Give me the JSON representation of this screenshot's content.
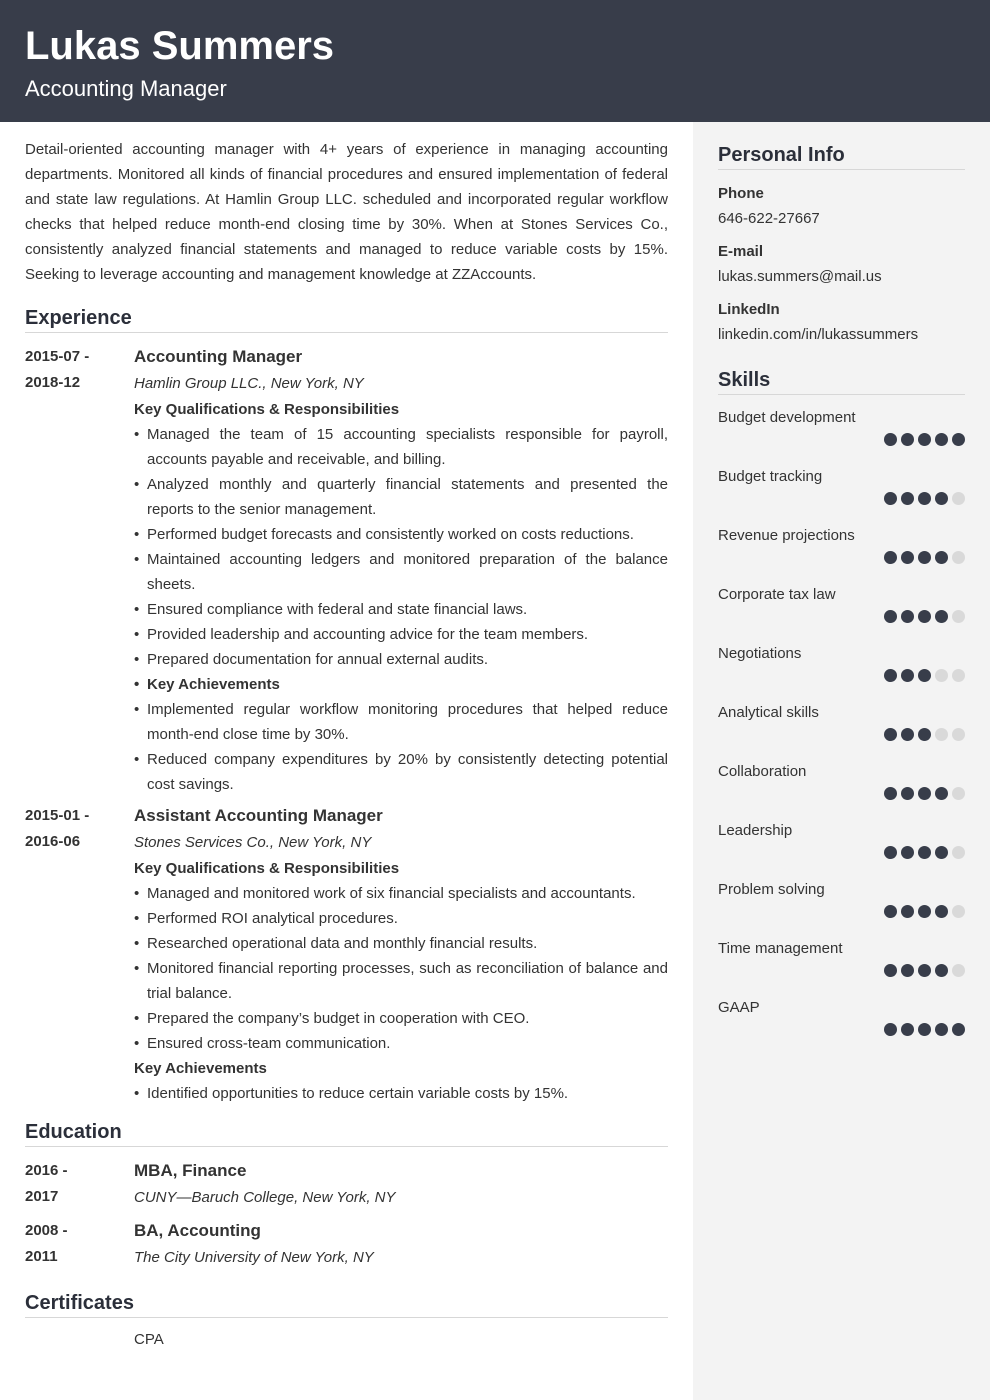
{
  "header": {
    "name": "Lukas Summers",
    "title": "Accounting Manager"
  },
  "summary": "Detail-oriented accounting manager with 4+ years of experience in managing accounting departments. Monitored all kinds of financial procedures and ensured implementation of federal and state law regulations. At Hamlin Group LLC. scheduled and incorporated regular workflow checks that helped reduce month-end closing time by 30%. When at Stones Services Co., consistently analyzed financial statements and managed to reduce variable costs by 15%. Seeking to leverage accounting and management knowledge at ZZAccounts.",
  "experience": {
    "heading": "Experience",
    "jobs": [
      {
        "date_start": "2015-07 -",
        "date_end": "2018-12",
        "title": "Accounting Manager",
        "company": "Hamlin Group LLC., New York, NY",
        "qual_heading": "Key Qualifications & Responsibilities",
        "bullets": [
          "Managed the team of 15 accounting specialists responsible for payroll, accounts payable and receivable, and billing.",
          "Analyzed monthly and quarterly financial statements and presented the reports to the senior management.",
          "Performed budget forecasts and consistently worked on costs reductions.",
          "Maintained accounting ledgers and monitored preparation of the balance sheets.",
          "Ensured compliance with federal and state financial laws.",
          "Provided leadership and accounting advice for the team members.",
          "Prepared documentation for annual external audits."
        ],
        "achievements_heading": "Key Achievements",
        "achievements": [
          "Implemented regular workflow monitoring procedures that helped reduce month-end close time by 30%.",
          "Reduced company expenditures by 20% by consistently detecting potential cost savings."
        ]
      },
      {
        "date_start": "2015-01 -",
        "date_end": "2016-06",
        "title": "Assistant Accounting Manager",
        "company": "Stones Services Co., New York, NY",
        "qual_heading": "Key Qualifications & Responsibilities",
        "bullets": [
          "Managed and monitored work of six financial specialists and accountants.",
          "Performed ROI analytical procedures.",
          "Researched operational data and monthly financial results.",
          "Monitored financial reporting processes, such as reconciliation of balance and trial balance.",
          "Prepared the company’s budget in cooperation with CEO.",
          "Ensured cross-team communication."
        ],
        "achievements_heading": "Key Achievements",
        "achievements": [
          "Identified opportunities to reduce certain variable costs by 15%."
        ]
      }
    ]
  },
  "education": {
    "heading": "Education",
    "items": [
      {
        "date_start": "2016 -",
        "date_end": "2017",
        "degree": "MBA, Finance",
        "school": "CUNY—Baruch College, New York, NY"
      },
      {
        "date_start": "2008 -",
        "date_end": "2011",
        "degree": "BA, Accounting",
        "school": "The City University of New York, NY"
      }
    ]
  },
  "certificates": {
    "heading": "Certificates",
    "items": [
      "CPA"
    ]
  },
  "personal_info": {
    "heading": "Personal Info",
    "phone_label": "Phone",
    "phone": "646-622-27667",
    "email_label": "E-mail",
    "email": "lukas.summers@mail.us",
    "linkedin_label": "LinkedIn",
    "linkedin": "linkedin.com/in/lukassummers"
  },
  "skills": {
    "heading": "Skills",
    "max_level": 5,
    "items": [
      {
        "name": "Budget development",
        "level": 5
      },
      {
        "name": "Budget tracking",
        "level": 4
      },
      {
        "name": "Revenue projections",
        "level": 4
      },
      {
        "name": "Corporate tax law",
        "level": 4
      },
      {
        "name": "Negotiations",
        "level": 3
      },
      {
        "name": "Analytical skills",
        "level": 3
      },
      {
        "name": "Collaboration",
        "level": 4
      },
      {
        "name": "Leadership",
        "level": 4
      },
      {
        "name": "Problem solving",
        "level": 4
      },
      {
        "name": "Time management",
        "level": 4
      },
      {
        "name": "GAAP",
        "level": 5
      }
    ]
  }
}
